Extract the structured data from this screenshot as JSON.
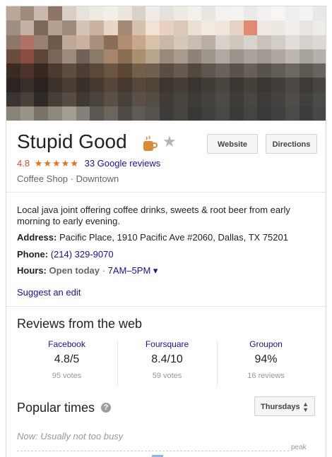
{
  "place": {
    "name": "Stupid Good",
    "rating": "4.8",
    "stars": "★★★★★",
    "reviews_count": "33 Google reviews",
    "category": "Coffee Shop · Downtown"
  },
  "buttons": {
    "website": "Website",
    "directions": "Directions"
  },
  "description": "Local java joint offering coffee drinks, sweets & root beer from early morning to early evening.",
  "address": {
    "label": "Address:",
    "value": "Pacific Place, 1910 Pacific Ave #2060, Dallas, TX 75201"
  },
  "phone": {
    "label": "Phone:",
    "value": "(214) 329-9070"
  },
  "hours": {
    "label": "Hours:",
    "status": "Open today",
    "separator": " · ",
    "value": "7AM–5PM",
    "caret": "▾"
  },
  "suggest_edit": "Suggest an edit",
  "reviews_web": {
    "title": "Reviews from the web",
    "sources": [
      {
        "name": "Facebook",
        "score": "4.8/5",
        "votes": "95 votes"
      },
      {
        "name": "Foursquare",
        "score": "8.4/10",
        "votes": "59 votes"
      },
      {
        "name": "Groupon",
        "score": "94%",
        "votes": "16 reviews"
      }
    ]
  },
  "popular_times": {
    "title": "Popular times",
    "help_icon": "?",
    "day_selector": "Thursdays",
    "status": "Now: Usually not too busy",
    "peak_label": "peak"
  },
  "colors": {
    "link": "#1a0dab",
    "rating": "#dd4b39",
    "stars": "#e7711b",
    "cup_icon": "#d98b3a"
  },
  "icons": {
    "cup": "coffee-cup-icon",
    "save": "star-outline-icon",
    "help": "help-circle-icon",
    "sort": "up-down-arrows-icon"
  }
}
